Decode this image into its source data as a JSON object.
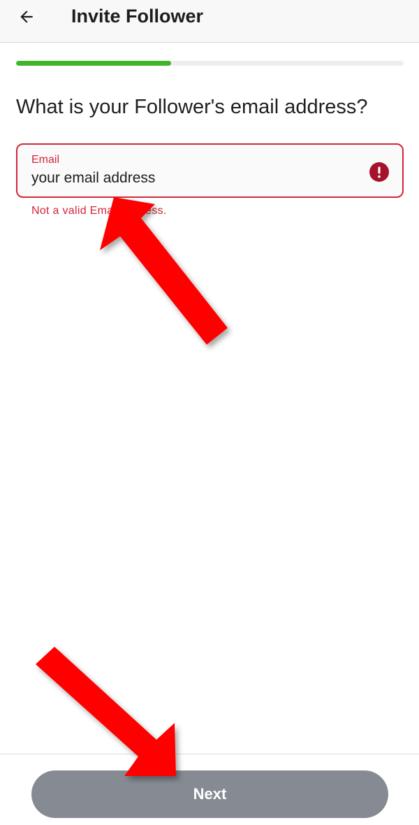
{
  "app_bar": {
    "title": "Invite Follower",
    "back_icon": "arrow-left-icon"
  },
  "progress": {
    "fraction": 0.4,
    "color": "#3fb52a"
  },
  "form": {
    "question": "What is your Follower's email address?",
    "email_field": {
      "label": "Email",
      "value": "your email address",
      "error_icon": "error-circle-icon",
      "helper_text": "Not a valid Email address.",
      "error_color": "#d3263a"
    }
  },
  "footer": {
    "next_label": "Next",
    "button_color": "#868b93"
  },
  "annotation_color": "#ff0000"
}
